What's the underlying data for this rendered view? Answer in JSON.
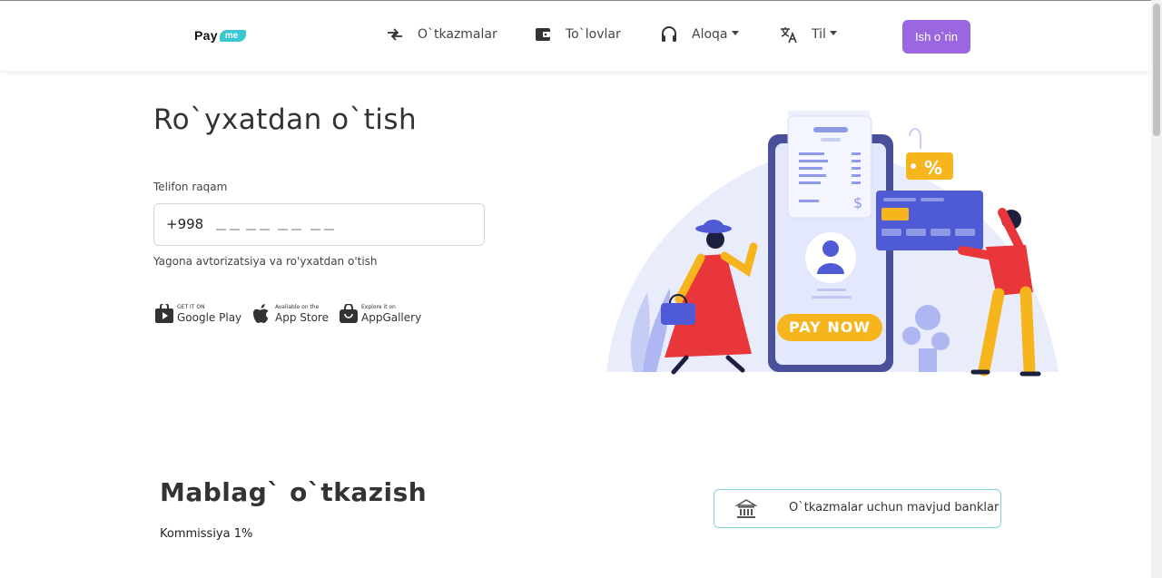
{
  "header": {
    "logo": {
      "pay": "Pay",
      "me": "me"
    },
    "nav": [
      {
        "label": "O`tkazmalar",
        "icon": "transfer-icon"
      },
      {
        "label": "To`lovlar",
        "icon": "wallet-icon"
      },
      {
        "label": "Aloqa",
        "icon": "headset-icon",
        "dropdown": true
      },
      {
        "label": "Til",
        "icon": "translate-icon",
        "dropdown": true
      }
    ],
    "cta_label": "Ish o`rin"
  },
  "registration": {
    "title": "Ro`yxatdan o`tish",
    "phone_label": "Telifon raqam",
    "phone_prefix": "+998",
    "phone_mask": "__ __ __  __ __  __ __",
    "note": "Yagona avtorizatsiya va ro'yxatdan o'tish"
  },
  "stores": [
    {
      "small": "GET IT ON",
      "big": "Google Play",
      "icon": "google-play-icon"
    },
    {
      "small": "Avaliable on the",
      "big": "App Store",
      "icon": "apple-icon"
    },
    {
      "small": "Explore it on",
      "big": "AppGallery",
      "icon": "appgallery-icon"
    }
  ],
  "illustration": {
    "pay_now": "PAY NOW",
    "tag": "%",
    "receipt_symbol": "$"
  },
  "transfers": {
    "title": "Mablag` o`tkazish",
    "commission": "Kommissiya 1%",
    "banks_button": "O`tkazmalar uchun mavjud banklar"
  },
  "colors": {
    "accent": "#9b67e0",
    "brand": "#38c6d0",
    "illustration_primary": "#4f5bd5",
    "pay_now": "#f6b51d"
  }
}
